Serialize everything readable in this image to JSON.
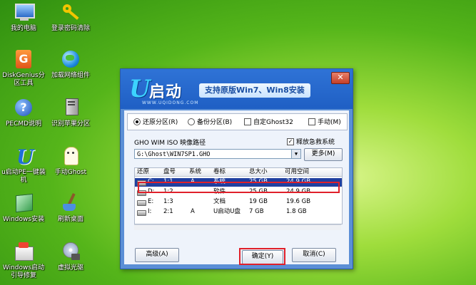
{
  "desktop": {
    "icons": [
      {
        "label": "我的电脑",
        "icon": "computer-icon"
      },
      {
        "label": "登录密码清除",
        "icon": "key-icon"
      },
      {
        "label": "DiskGenius分区工具",
        "icon": "diskgenius-icon"
      },
      {
        "label": "加载网络组件",
        "icon": "network-globe-icon"
      },
      {
        "label": "PECMD说明",
        "icon": "help-icon"
      },
      {
        "label": "识别苹果分区",
        "icon": "drive-icon"
      },
      {
        "label": "u启动PE一键装机",
        "icon": "u-logo-icon"
      },
      {
        "label": "手动Ghost",
        "icon": "ghost-icon"
      },
      {
        "label": "Windows安装",
        "icon": "windows-install-icon"
      },
      {
        "label": "刷新桌面",
        "icon": "broom-icon"
      },
      {
        "label": "Windows启动引导修复",
        "icon": "boot-repair-icon"
      },
      {
        "label": "虚拟光驱",
        "icon": "virtual-drive-icon"
      }
    ]
  },
  "dialog": {
    "logo_u": "U",
    "logo_text": "启动",
    "logo_sub": "WWW.UQIDONG.COM",
    "slogan": "支持原版Win7、Win8安装",
    "close_label": "✕",
    "options": {
      "restore": "还原分区(R)",
      "backup": "备份分区(B)",
      "custom_ghost": "自定Ghost32",
      "manual": "手动(M)"
    },
    "path_label": "GHO WIM ISO 映像路径",
    "rescue_label": "释放急救系统",
    "path_value": "G:\\Ghost\\WIN7SP1.GHO",
    "more_button": "更多(M)",
    "table": {
      "headers": [
        "还原",
        "盘号",
        "系统",
        "卷标",
        "总大小",
        "可用空间"
      ],
      "rows": [
        [
          "C:",
          "1:1",
          "A",
          "系统",
          "25 GB",
          "24.9 GB"
        ],
        [
          "D:",
          "1:2",
          "",
          "软件",
          "25 GB",
          "24.9 GB"
        ],
        [
          "E:",
          "1:3",
          "",
          "文档",
          "19 GB",
          "19.6 GB"
        ],
        [
          "I:",
          "2:1",
          "A",
          "U启动U盘",
          "7 GB",
          "1.8 GB"
        ]
      ],
      "selected_row": 0
    },
    "buttons": {
      "advanced": "高级(A)",
      "ok": "确定(Y)",
      "cancel": "取消(C)"
    }
  },
  "colors": {
    "selection": "#1f3fa0",
    "highlight_border": "#e0202a",
    "title_blue": "#1f5fc4"
  }
}
